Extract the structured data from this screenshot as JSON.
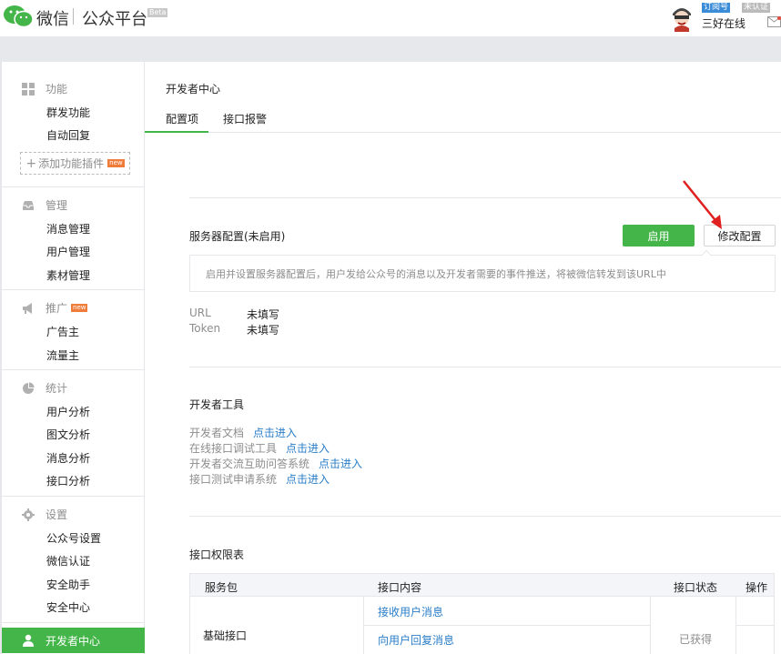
{
  "header": {
    "brand_name": "微信",
    "brand_sub": "公众平台",
    "beta": "Beta",
    "account_type": "订阅号",
    "account_verify": "未认证",
    "account_name": "三好在线"
  },
  "sidebar": {
    "groups": [
      {
        "title": "功能",
        "icon": "grid-icon",
        "items": [
          "群发功能",
          "自动回复"
        ]
      },
      {
        "title": "管理",
        "icon": "inbox-icon",
        "items": [
          "消息管理",
          "用户管理",
          "素材管理"
        ]
      },
      {
        "title": "推广",
        "icon": "megaphone-icon",
        "badge": "new",
        "items": [
          "广告主",
          "流量主"
        ]
      },
      {
        "title": "统计",
        "icon": "pie-chart-icon",
        "items": [
          "用户分析",
          "图文分析",
          "消息分析",
          "接口分析"
        ]
      },
      {
        "title": "设置",
        "icon": "gear-icon",
        "items": [
          "公众号设置",
          "微信认证",
          "安全助手",
          "安全中心"
        ]
      }
    ],
    "add_plugin": "添加功能插件",
    "add_plugin_badge": "new",
    "active_item": "开发者中心",
    "active_icon": "user-icon"
  },
  "main": {
    "page_title": "开发者中心",
    "tabs": [
      {
        "label": "配置项",
        "active": true
      },
      {
        "label": "接口报警",
        "active": false
      }
    ],
    "server_config": {
      "title": "服务器配置(未启用)",
      "enable_label": "启用",
      "modify_label": "修改配置",
      "notice": "启用并设置服务器配置后，用户发给公众号的消息以及开发者需要的事件推送，将被微信转发到该URL中",
      "fields": [
        {
          "label": "URL",
          "value": "未填写"
        },
        {
          "label": "Token",
          "value": "未填写"
        }
      ]
    },
    "dev_tools": {
      "title": "开发者工具",
      "items": [
        {
          "name": "开发者文档",
          "link": "点击进入"
        },
        {
          "name": "在线接口调试工具",
          "link": "点击进入"
        },
        {
          "name": "开发者交流互助问答系统",
          "link": "点击进入"
        },
        {
          "name": "接口测试申请系统",
          "link": "点击进入"
        }
      ]
    },
    "permissions": {
      "title": "接口权限表",
      "columns": [
        "服务包",
        "接口内容",
        "接口状态",
        "操作"
      ],
      "rows": [
        {
          "package": "基础接口",
          "items": [
            "接收用户消息",
            "向用户回复消息"
          ],
          "status": "已获得"
        }
      ]
    }
  },
  "colors": {
    "accent": "#44b549",
    "link": "#2a7ec8",
    "annotation_arrow": "#e02020"
  }
}
